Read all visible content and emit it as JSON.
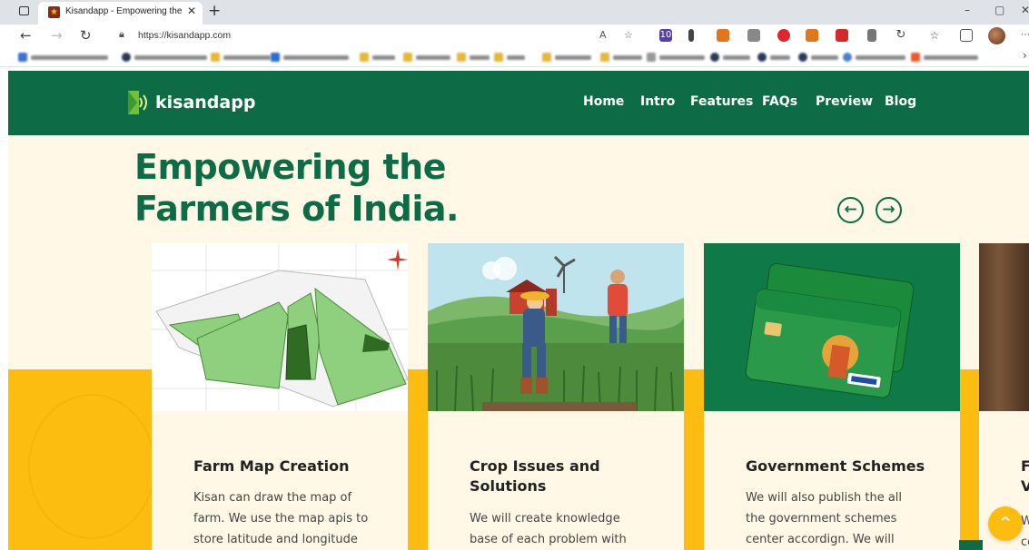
{
  "browser": {
    "tab_title": "Kisandapp - Empowering the far",
    "tab_close": "✕",
    "new_tab": "+",
    "url": "https://kisandapp.com",
    "window_controls": [
      "–",
      "▢",
      "✕"
    ],
    "toolbar_icons": [
      "back-icon",
      "forward-icon",
      "refresh-icon",
      "read-aloud-icon",
      "add-favorite-icon",
      "favorites-icon",
      "collections-icon",
      "profile-avatar",
      "more-icon"
    ],
    "extension_badge": "10",
    "favorites_blurred": true
  },
  "site": {
    "brand": "kisandapp",
    "nav": [
      "Home",
      "Intro",
      "Features",
      "FAQs",
      "Preview",
      "Blog"
    ],
    "hero_title_line1": "Empowering the",
    "hero_title_line2": "Farmers of India.",
    "prev_arrow": "←",
    "next_arrow": "→",
    "cards": [
      {
        "title": "Farm Map Creation",
        "description": [
          "Kisan can draw the map of",
          "farm. We use the map apis to",
          "store latitude and longitude"
        ]
      },
      {
        "title_line1": "Crop Issues and",
        "title_line2": "Solutions",
        "description": [
          "We will create knowledge",
          "base of each problem with"
        ]
      },
      {
        "title": "Government Schemes",
        "description": [
          "We will also publish the all",
          "the government schemes",
          "center accordign. We will"
        ]
      }
    ],
    "partial_card_title": [
      "F",
      "V"
    ],
    "partial_card_desc": [
      "W",
      "co"
    ],
    "scroll_top": "^"
  },
  "colors": {
    "brand_green": "#0d6b45",
    "accent_yellow": "#fdbd10",
    "cream": "#fff8e6"
  }
}
